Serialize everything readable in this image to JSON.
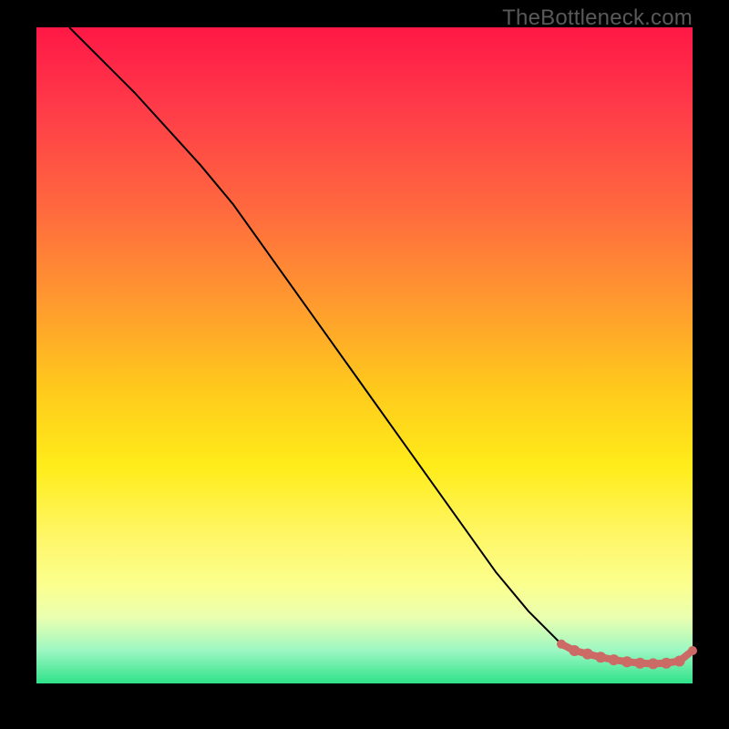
{
  "watermark": "TheBottleneck.com",
  "chart_data": {
    "type": "line",
    "title": "",
    "xlabel": "",
    "ylabel": "",
    "xlim": [
      0,
      100
    ],
    "ylim": [
      0,
      100
    ],
    "series": [
      {
        "name": "curve",
        "style": "line",
        "color": "#000000",
        "x": [
          5,
          10,
          15,
          20,
          25,
          30,
          35,
          40,
          45,
          50,
          55,
          60,
          65,
          70,
          75,
          80,
          82,
          85,
          88,
          90,
          92,
          95,
          98,
          100
        ],
        "values": [
          100,
          95,
          90,
          84.5,
          79,
          73,
          66,
          59,
          52,
          45,
          38,
          31,
          24,
          17,
          11,
          6,
          5,
          4,
          3.5,
          3.2,
          3,
          3,
          3.5,
          5
        ]
      },
      {
        "name": "dots",
        "style": "scatter",
        "color": "#cc6a66",
        "x": [
          80,
          82,
          84,
          86,
          88,
          90,
          92,
          94,
          96,
          98,
          100
        ],
        "values": [
          6,
          5,
          4.5,
          4.0,
          3.6,
          3.3,
          3.1,
          3.0,
          3.1,
          3.4,
          5
        ]
      }
    ],
    "note": "Axes have no visible tick labels; values above are estimated on a 0-100 normalized scale from visual position."
  }
}
